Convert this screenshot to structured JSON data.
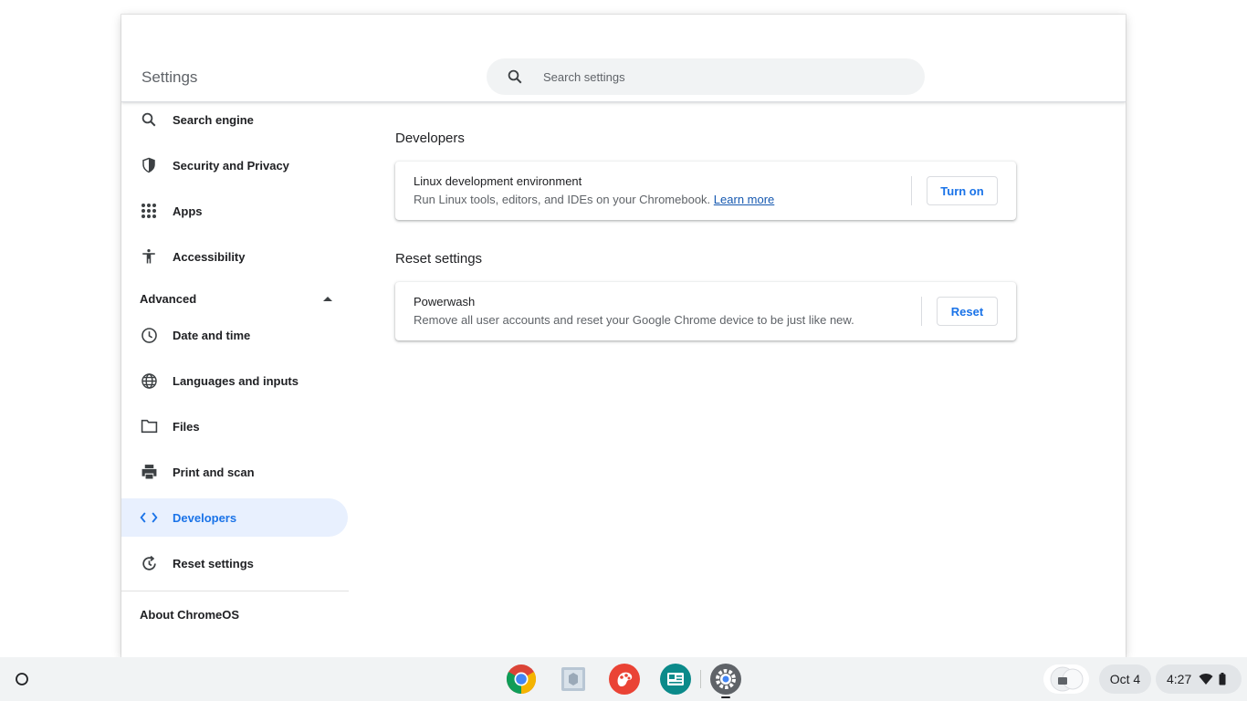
{
  "window": {
    "app_title": "Settings",
    "search_placeholder": "Search settings",
    "controls": [
      "minimize",
      "maximize",
      "close"
    ]
  },
  "sidebar": {
    "items": [
      {
        "label": "Search engine",
        "icon": "search-icon"
      },
      {
        "label": "Security and Privacy",
        "icon": "shield-icon"
      },
      {
        "label": "Apps",
        "icon": "apps-grid-icon"
      },
      {
        "label": "Accessibility",
        "icon": "accessibility-icon"
      }
    ],
    "advanced_label": "Advanced",
    "advanced_items": [
      {
        "label": "Date and time",
        "icon": "clock-icon"
      },
      {
        "label": "Languages and inputs",
        "icon": "globe-icon"
      },
      {
        "label": "Files",
        "icon": "folder-icon"
      },
      {
        "label": "Print and scan",
        "icon": "printer-icon"
      },
      {
        "label": "Developers",
        "icon": "code-icon",
        "active": true
      },
      {
        "label": "Reset settings",
        "icon": "reset-icon"
      }
    ],
    "about_label": "About ChromeOS"
  },
  "main": {
    "developers": {
      "title": "Developers",
      "card": {
        "title": "Linux development environment",
        "subtitle": "Run Linux tools, editors, and IDEs on your Chromebook.",
        "link": "Learn more",
        "button": "Turn on"
      }
    },
    "reset": {
      "title": "Reset settings",
      "card": {
        "title": "Powerwash",
        "subtitle": "Remove all user accounts and reset your Google Chrome device to be just like new.",
        "button": "Reset"
      }
    }
  },
  "shelf": {
    "apps": [
      "chrome",
      "files",
      "canvas",
      "classroom",
      "settings"
    ],
    "date": "Oct 4",
    "time": "4:27"
  },
  "colors": {
    "accent": "#1a73e8",
    "active_bg": "#e8f0fe",
    "shelf_bg": "#f1f3f4"
  }
}
